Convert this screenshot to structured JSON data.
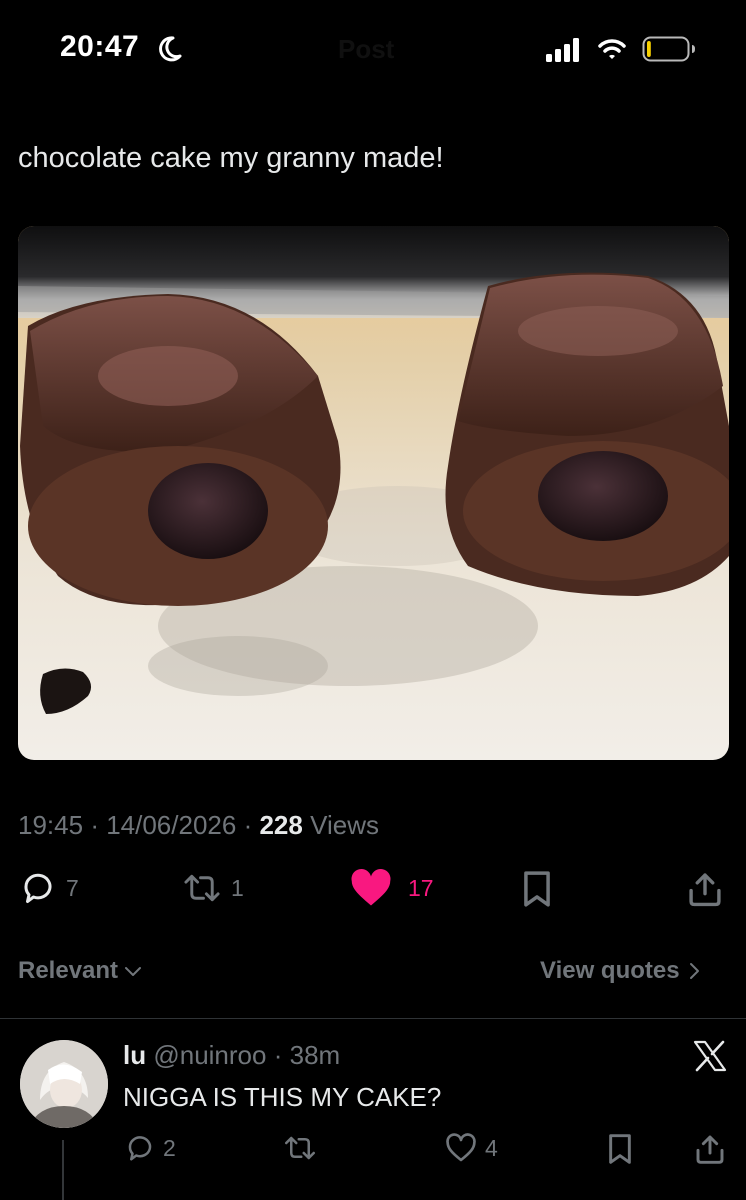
{
  "status_bar": {
    "time": "20:47"
  },
  "nav": {
    "title": "Post"
  },
  "post": {
    "text": "chocolate cake my granny made!",
    "time": "19:45",
    "date": "14/06/2026",
    "views_count": "228",
    "views_label": "Views",
    "replies": "7",
    "reposts": "1",
    "likes": "17"
  },
  "filters": {
    "relevant_label": "Relevant",
    "view_quotes_label": "View quotes"
  },
  "reply": {
    "name": "lu",
    "handle": "@nuinroo",
    "age": "38m",
    "text": "NIGGA IS THIS MY CAKE?",
    "replies": "2",
    "likes": "4"
  },
  "colors": {
    "background": "#000000",
    "text": "#e7e9ea",
    "muted": "#71767b",
    "like": "#f91880",
    "battery_level": "#f7d000"
  },
  "icons": [
    "moon-icon",
    "signal-icon",
    "wifi-icon",
    "battery-icon",
    "reply-icon",
    "retweet-icon",
    "heart-filled-icon",
    "bookmark-icon",
    "share-icon",
    "chevron-down-icon",
    "chevron-right-icon",
    "x-logo-icon",
    "heart-outline-icon"
  ],
  "battery": {
    "level_fraction": 0.1
  }
}
